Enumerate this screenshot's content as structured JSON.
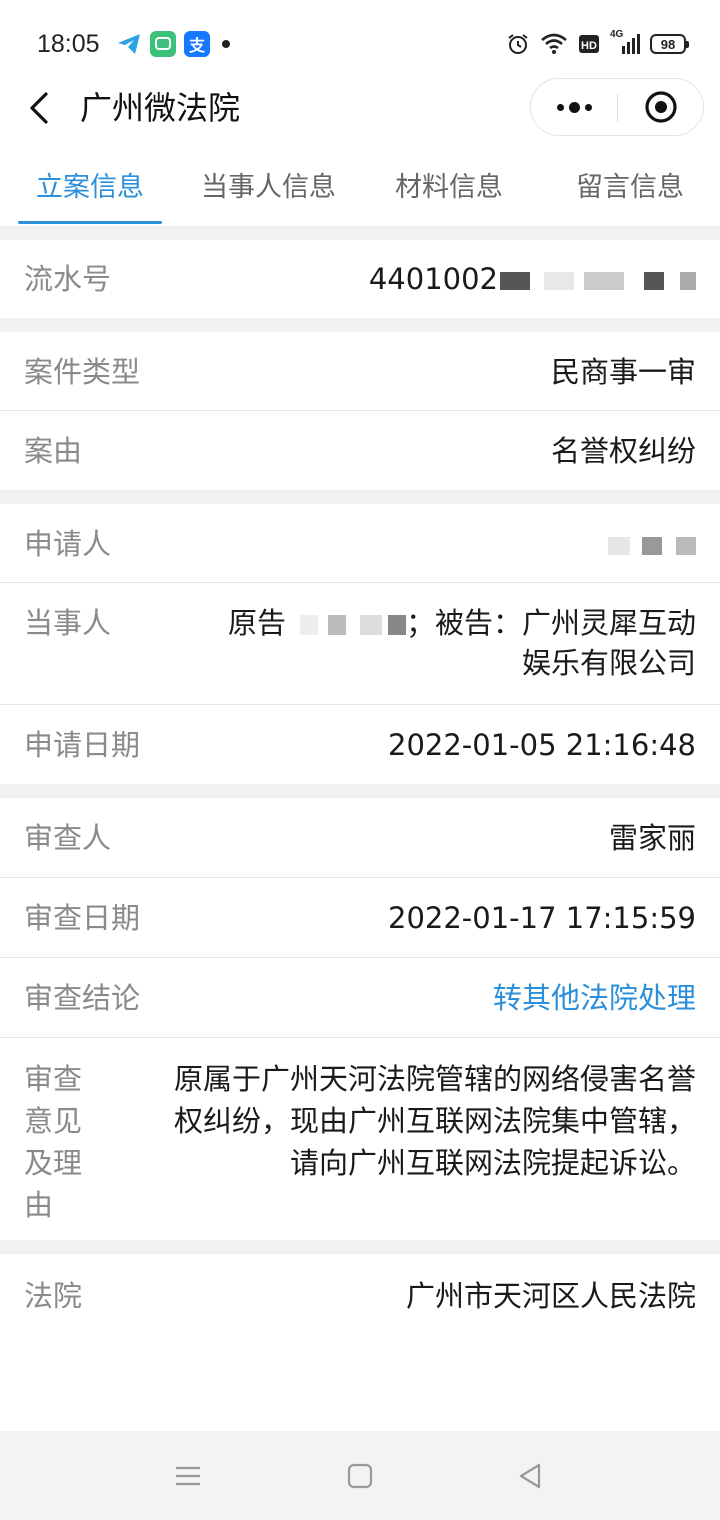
{
  "status_bar": {
    "time": "18:05",
    "battery": "98",
    "signal_label": "4G",
    "app_icons": [
      "telegram-icon",
      "chat-icon",
      "alipay-icon"
    ],
    "alipay_glyph": "支"
  },
  "header": {
    "title": "广州微法院",
    "back_icon": "chevron-left-icon",
    "more_icon": "more-dots-icon",
    "close_icon": "target-close-icon"
  },
  "tabs": [
    {
      "label": "立案信息",
      "active": true
    },
    {
      "label": "当事人信息",
      "active": false
    },
    {
      "label": "材料信息",
      "active": false
    },
    {
      "label": "留言信息",
      "active": false
    }
  ],
  "case": {
    "serial": {
      "label": "流水号",
      "value_prefix": "4401002"
    },
    "case_type": {
      "label": "案件类型",
      "value": "民商事一审"
    },
    "cause": {
      "label": "案由",
      "value": "名誉权纠纷"
    },
    "applicant": {
      "label": "申请人"
    },
    "parties": {
      "label": "当事人",
      "plaintiff_label": "原告",
      "defendant_text": "；被告：广州灵犀互动",
      "defendant_line2": "娱乐有限公司"
    },
    "apply_date": {
      "label": "申请日期",
      "value": "2022-01-05 21:16:48"
    },
    "reviewer": {
      "label": "审查人",
      "value": "雷家丽"
    },
    "review_date": {
      "label": "审查日期",
      "value": "2022-01-17 17:15:59"
    },
    "review_conclusion": {
      "label": "审查结论",
      "value": "转其他法院处理"
    },
    "review_opinion": {
      "label_lines": [
        "审查",
        "意见",
        "及理",
        "由"
      ],
      "value_lines": [
        "原属于广州天河法院管辖的网络侵害名誉",
        "权纠纷，现由广州互联网法院集中管辖，",
        "请向广州互联网法院提起诉讼。"
      ]
    },
    "court": {
      "label": "法院",
      "value": "广州市天河区人民法院"
    }
  },
  "colors": {
    "accent": "#2b8fd9",
    "label_gray": "#8a8a8a",
    "divider": "#e6e6e6",
    "section_gap": "#f1f1f1"
  }
}
